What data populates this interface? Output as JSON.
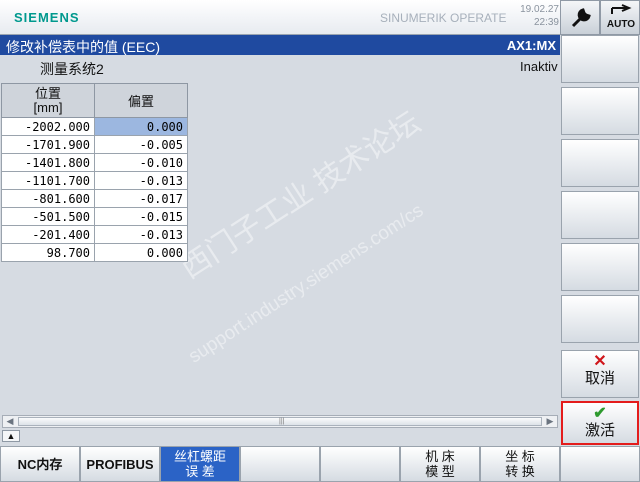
{
  "header": {
    "brand": "SIEMENS",
    "product": "SINUMERIK OPERATE",
    "date": "19.02.27",
    "time": "22:39",
    "auto_label": "AUTO"
  },
  "title": {
    "text": "修改补偿表中的值 (EEC)",
    "axis": "AX1:MX"
  },
  "sub": {
    "system": "测量系统2",
    "status": "Inaktiv"
  },
  "table": {
    "col1_line1": "位置",
    "col1_line2": "[mm]",
    "col2": "偏置",
    "rows": [
      {
        "pos": "-2002.000",
        "off": "0.000"
      },
      {
        "pos": "-1701.900",
        "off": "-0.005"
      },
      {
        "pos": "-1401.800",
        "off": "-0.010"
      },
      {
        "pos": "-1101.700",
        "off": "-0.013"
      },
      {
        "pos": "-801.600",
        "off": "-0.017"
      },
      {
        "pos": "-501.500",
        "off": "-0.015"
      },
      {
        "pos": "-201.400",
        "off": "-0.013"
      },
      {
        "pos": "98.700",
        "off": "0.000"
      }
    ]
  },
  "watermark": {
    "line1": "西门子工业 技术论坛",
    "line2": "support.industry.siemens.com/cs"
  },
  "softkeys_right": {
    "cancel": "取消",
    "activate": "激活"
  },
  "softkeys_bottom": {
    "nc": "NC内存",
    "profibus": "PROFIBUS",
    "screw_1": "丝杠螺距",
    "screw_2": "误 差",
    "machine_1": "机 床",
    "machine_2": "模 型",
    "coord_1": "坐 标",
    "coord_2": "转 换"
  },
  "colors": {
    "brand": "#00998e",
    "titlebar": "#1f4aa0",
    "selected_cell": "#9cb7e0",
    "active_softkey": "#2b63c6",
    "cancel_icon": "#d0161b",
    "activate_icon": "#2e9a2e",
    "highlight_border": "#e41c1c"
  }
}
